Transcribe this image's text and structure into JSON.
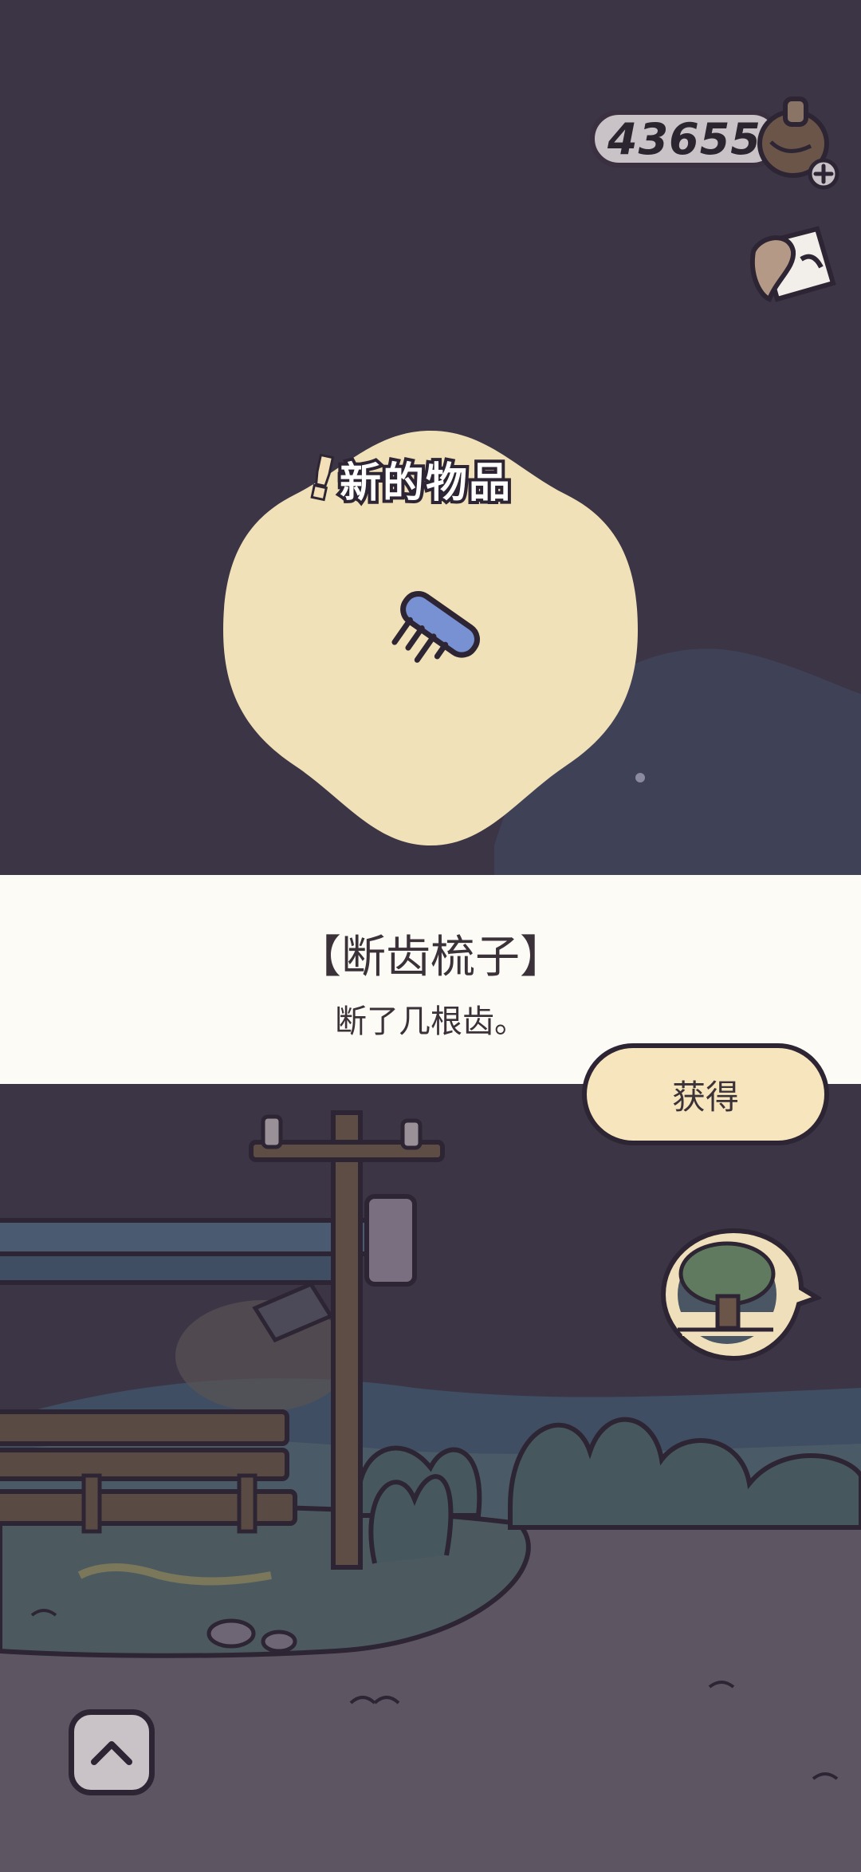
{
  "hud": {
    "currency_value": "436559",
    "currency_icon": "coin-bag-icon",
    "add_icon": "plus-icon",
    "notebook_icon": "notebook-icon"
  },
  "popup": {
    "title": "新的物品",
    "item_icon": "comb-icon",
    "item_name": "【断齿梳子】",
    "item_description": "断了几根齿。",
    "obtain_label": "获得"
  },
  "scene": {
    "tree_icon": "tree-icon",
    "up_icon": "chevron-up-icon"
  },
  "colors": {
    "night_sky": "#3b3546",
    "reveal_blob": "#f0e1b8",
    "comb_blue": "#7891d2",
    "button_fill": "#f7e6bd",
    "outline": "#2d2533"
  }
}
